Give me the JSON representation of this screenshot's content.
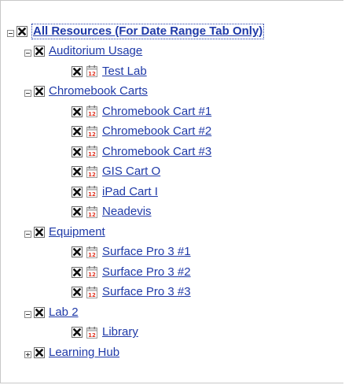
{
  "tree": {
    "root": {
      "label": "All Resources (For Date Range Tab Only)",
      "expanded": true,
      "checked": true
    },
    "groups": [
      {
        "label": "Auditorium Usage",
        "expanded": true,
        "items": [
          "Test Lab"
        ]
      },
      {
        "label": "Chromebook Carts",
        "expanded": true,
        "items": [
          "Chromebook Cart #1",
          "Chromebook Cart #2",
          "Chromebook Cart #3",
          "GIS Cart O",
          "iPad Cart I",
          "Neadevis"
        ]
      },
      {
        "label": "Equipment",
        "expanded": true,
        "items": [
          "Surface Pro 3 #1",
          "Surface Pro 3 #2",
          "Surface Pro 3 #3"
        ]
      },
      {
        "label": "Lab 2",
        "expanded": true,
        "items": [
          "Library"
        ]
      },
      {
        "label": "Learning Hub",
        "expanded": false,
        "items": []
      }
    ]
  },
  "icons": {
    "expand_collapse": "tree-toggle-icon",
    "checkbox": "x-checkbox-icon",
    "resource": "calendar-icon"
  },
  "colors": {
    "link": "#1f3aa8",
    "calendar_accent": "#e0301e"
  }
}
